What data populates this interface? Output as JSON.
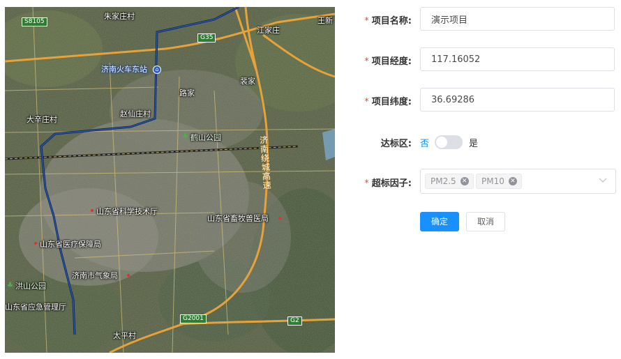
{
  "map": {
    "labels": {
      "zhujiazhuang": "朱家庄村",
      "jiangjiazhuang": "江家庄",
      "wangxin": "王新",
      "jinan_east_station": "济南火车东站",
      "lujia": "路家",
      "peijia": "裴家",
      "zhaoxianzhuang": "赵仙庄村",
      "daxinzhuang": "大辛庄村",
      "heshan_park": "鹤山公园",
      "expressway": "济南绕城高速",
      "sd_sci_tech": "山东省科学技术厅",
      "sd_livestock": "山东省畜牧兽医局",
      "sd_medical_security": "山东省医疗保障局",
      "jinan_weather": "济南市气象局",
      "hongshan_park": "洪山公园",
      "sd_emergency": "山东省应急管理厅",
      "taiping": "太平村"
    },
    "shields": {
      "s8105": "S8105",
      "g35": "G35",
      "g2001": "G2001",
      "g2": "G2"
    }
  },
  "form": {
    "name": {
      "label": "项目名称:",
      "value": "演示项目"
    },
    "longitude": {
      "label": "项目经度:",
      "value": "117.16052"
    },
    "latitude": {
      "label": "项目纬度:",
      "value": "36.69286"
    },
    "compliance": {
      "label": "达标区:",
      "off_label": "否",
      "on_label": "是",
      "checked": false
    },
    "factors": {
      "label": "超标因子:",
      "tags": [
        "PM2.5",
        "PM10"
      ]
    },
    "required_mark": "*",
    "confirm_label": "确定",
    "cancel_label": "取消"
  }
}
